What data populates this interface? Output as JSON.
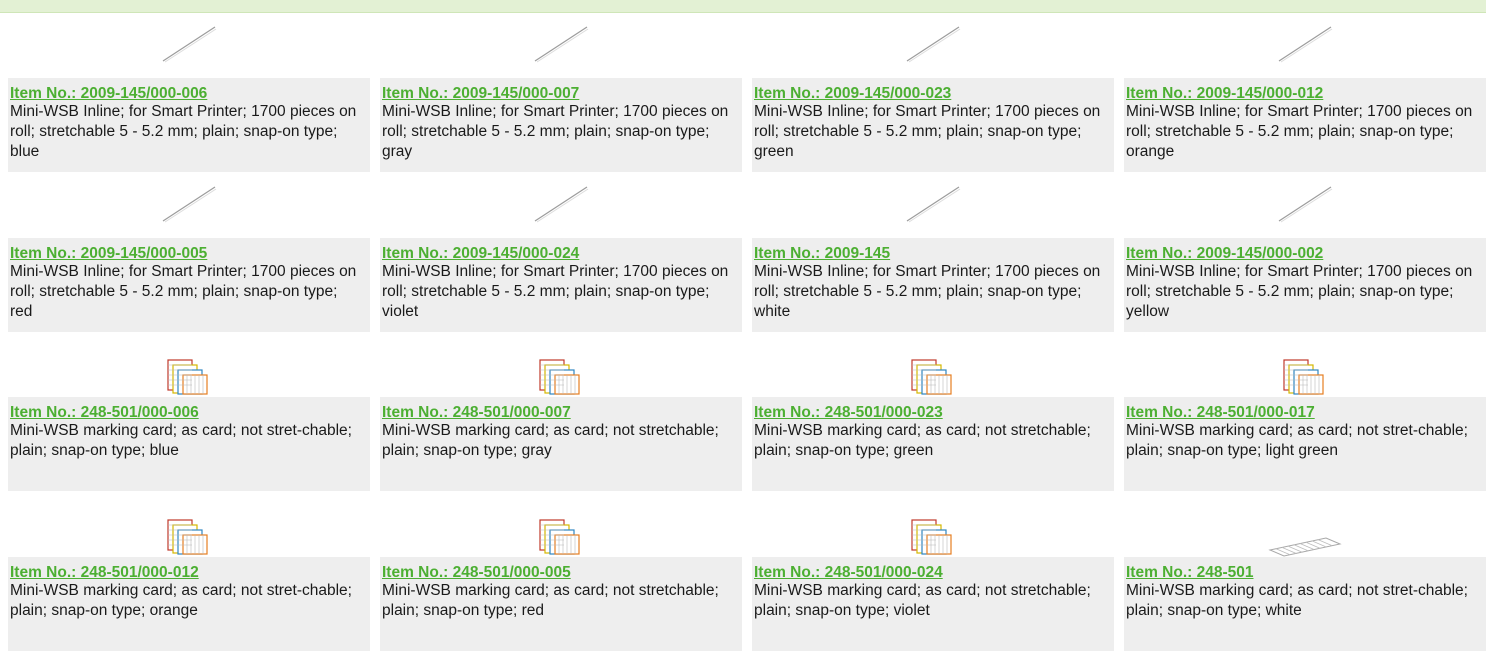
{
  "header": {
    "text": ""
  },
  "items": [
    {
      "image": "marker-strip-line-icon",
      "item_no": "Item No.: 2009-145/000-006",
      "desc": "Mini-WSB Inline; for Smart Printer; 1700 pieces on roll; stretchable 5 - 5.2 mm; plain; snap-on type; blue"
    },
    {
      "image": "marker-strip-line-icon",
      "item_no": "Item No.: 2009-145/000-007",
      "desc": "Mini-WSB Inline; for Smart Printer; 1700 pieces on roll; stretchable 5 - 5.2 mm; plain; snap-on type; gray"
    },
    {
      "image": "marker-strip-line-icon",
      "item_no": "Item No.: 2009-145/000-023",
      "desc": "Mini-WSB Inline; for Smart Printer; 1700 pieces on roll; stretchable 5 - 5.2 mm; plain; snap-on type; green"
    },
    {
      "image": "marker-strip-line-icon",
      "item_no": "Item No.: 2009-145/000-012",
      "desc": "Mini-WSB Inline; for Smart Printer; 1700 pieces on roll; stretchable 5 - 5.2 mm; plain; snap-on type; orange"
    },
    {
      "image": "marker-strip-line-icon",
      "item_no": "Item No.: 2009-145/000-005",
      "desc": "Mini-WSB Inline; for Smart Printer; 1700 pieces on roll; stretchable 5 - 5.2 mm; plain; snap-on type; red"
    },
    {
      "image": "marker-strip-line-icon",
      "item_no": "Item No.: 2009-145/000-024",
      "desc": "Mini-WSB Inline; for Smart Printer; 1700 pieces on roll; stretchable 5 - 5.2 mm; plain; snap-on type; violet"
    },
    {
      "image": "marker-strip-line-icon",
      "item_no": "Item No.: 2009-145",
      "desc": "Mini-WSB Inline; for Smart Printer; 1700 pieces on roll; stretchable 5 - 5.2 mm; plain; snap-on type; white"
    },
    {
      "image": "marker-strip-line-icon",
      "item_no": "Item No.: 2009-145/000-002",
      "desc": "Mini-WSB Inline; for Smart Printer; 1700 pieces on roll; stretchable 5 - 5.2 mm; plain; snap-on type; yellow"
    },
    {
      "image": "marking-card-stack-icon",
      "item_no": "Item No.: 248-501/000-006",
      "desc": "Mini-WSB marking card; as card; not stret-chable; plain; snap-on type; blue"
    },
    {
      "image": "marking-card-stack-icon",
      "item_no": "Item No.: 248-501/000-007",
      "desc": "Mini-WSB marking card; as card; not stretchable; plain; snap-on type; gray"
    },
    {
      "image": "marking-card-stack-icon",
      "item_no": "Item No.: 248-501/000-023",
      "desc": "Mini-WSB marking card; as card; not stretchable; plain; snap-on type; green"
    },
    {
      "image": "marking-card-stack-icon",
      "item_no": "Item No.: 248-501/000-017",
      "desc": "Mini-WSB marking card; as card; not stret-chable; plain; snap-on type; light green"
    },
    {
      "image": "marking-card-stack-icon",
      "item_no": "Item No.: 248-501/000-012",
      "desc": "Mini-WSB marking card; as card; not stret-chable; plain; snap-on type; orange"
    },
    {
      "image": "marking-card-stack-icon",
      "item_no": "Item No.: 248-501/000-005",
      "desc": "Mini-WSB marking card; as card; not stretchable; plain; snap-on type; red"
    },
    {
      "image": "marking-card-stack-icon",
      "item_no": "Item No.: 248-501/000-024",
      "desc": "Mini-WSB marking card; as card; not stretchable; plain; snap-on type; violet"
    },
    {
      "image": "marking-strip-white-icon",
      "item_no": "Item No.: 248-501",
      "desc": "Mini-WSB marking card; as card; not stret-chable; plain; snap-on type; white"
    }
  ],
  "colors": {
    "link": "#4caf32",
    "header_bg": "#e3f1d4",
    "card_bg": "#eeeeee"
  }
}
